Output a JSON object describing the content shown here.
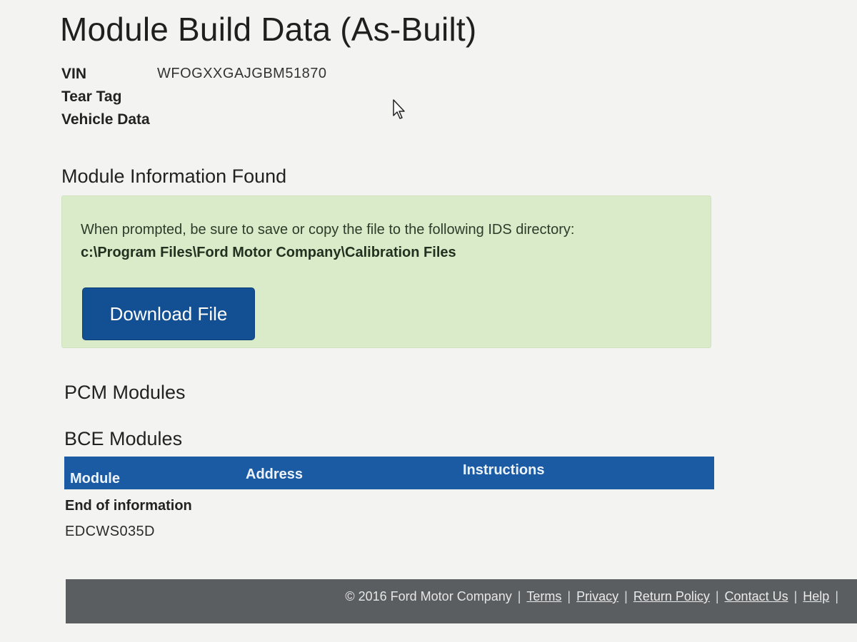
{
  "page": {
    "title": "Module Build Data (As-Built)"
  },
  "vehicle": {
    "vin_label": "VIN",
    "vin_value": "WFOGXXGAJGBM51870",
    "tear_tag_label": "Tear Tag",
    "vehicle_data_label": "Vehicle Data"
  },
  "module_info": {
    "heading": "Module Information Found",
    "message": "When prompted, be sure to save or copy the file to the following IDS directory:",
    "path": "c:\\Program Files\\Ford Motor Company\\Calibration Files",
    "download_label": "Download File"
  },
  "sections": {
    "pcm": "PCM Modules",
    "bce": "BCE Modules"
  },
  "table": {
    "columns": [
      "Module",
      "Address",
      "Instructions"
    ],
    "end_text": "End of information",
    "code": "EDCWS035D"
  },
  "footer": {
    "copyright": "© 2016 Ford Motor Company",
    "links": [
      "Terms",
      "Privacy",
      "Return Policy",
      "Contact Us",
      "Help"
    ]
  },
  "colors": {
    "background": "#f3f4f2",
    "alert_bg": "#d9ebc9",
    "button_bg": "#134f93",
    "table_header_bg": "#1b5ba3",
    "footer_bg": "#5b5e61"
  }
}
